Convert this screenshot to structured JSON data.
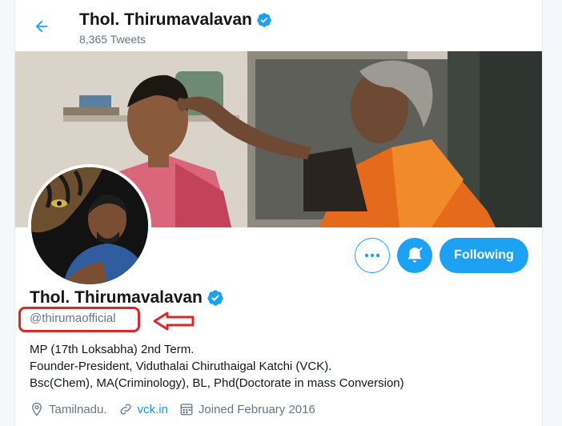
{
  "header": {
    "title": "Thol. Thirumavalavan",
    "tweets": "8,365 Tweets"
  },
  "actions": {
    "more_label": "More",
    "notifications_label": "Notifications",
    "follow_label": "Following"
  },
  "profile": {
    "name": "Thol. Thirumavalavan",
    "handle": "@thirumaofficial",
    "bio": [
      "MP (17th Loksabha) 2nd Term.",
      "Founder-President, Viduthalai Chiruthaigal Katchi (VCK).",
      "Bsc(Chem), MA(Criminology), BL, Phd(Doctorate in mass Conversion)"
    ],
    "location": "Tamilnadu.",
    "website": "vck.in",
    "joined": "Joined February 2016"
  },
  "colors": {
    "accent": "#1da1f2",
    "annotation": "#d62a2a"
  }
}
